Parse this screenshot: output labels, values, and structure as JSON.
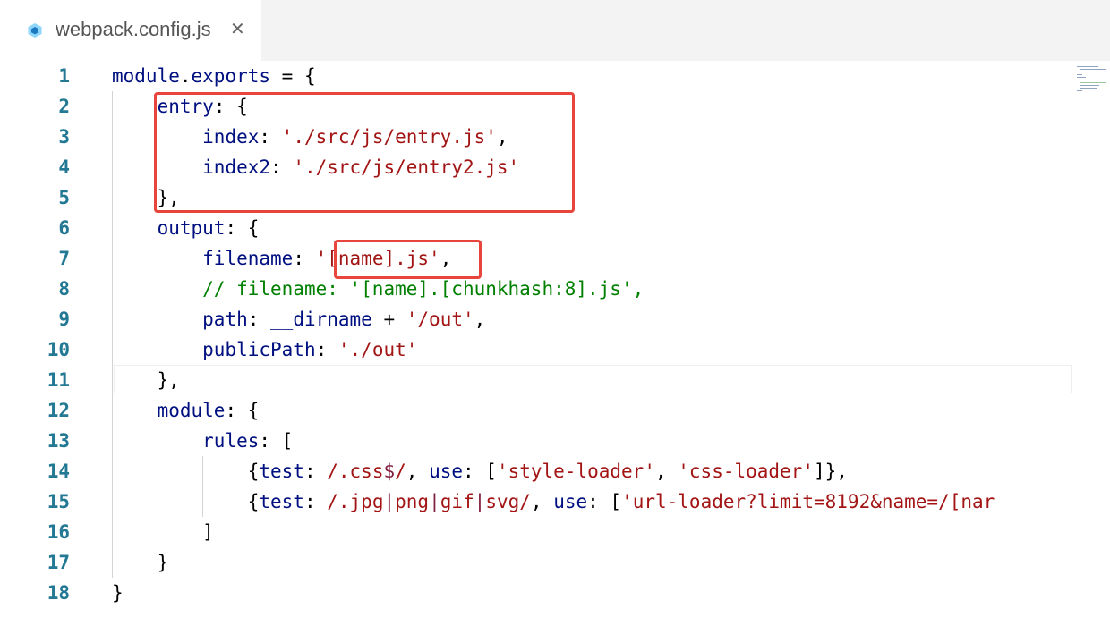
{
  "tab": {
    "icon": "webpack-cube-icon",
    "filename": "webpack.config.js",
    "close_glyph": "✕"
  },
  "editor": {
    "current_line": 11,
    "highlight_boxes": [
      "entry-block",
      "filename-value"
    ],
    "colors": {
      "line_number": "#237893",
      "property": "#001080",
      "string": "#a31515",
      "comment": "#008000",
      "highlight_box": "#e8453c"
    },
    "lines": [
      {
        "num": "1",
        "segs": [
          {
            "t": "module",
            "c": "k"
          },
          {
            "t": ".",
            "c": ""
          },
          {
            "t": "exports",
            "c": "k"
          },
          {
            "t": " = {",
            "c": ""
          }
        ]
      },
      {
        "num": "2",
        "segs": [
          {
            "t": "    ",
            "c": ""
          },
          {
            "t": "entry",
            "c": "k"
          },
          {
            "t": ": {",
            "c": ""
          }
        ]
      },
      {
        "num": "3",
        "segs": [
          {
            "t": "        ",
            "c": ""
          },
          {
            "t": "index",
            "c": "k"
          },
          {
            "t": ": ",
            "c": ""
          },
          {
            "t": "'./src/js/entry.js'",
            "c": "s"
          },
          {
            "t": ",",
            "c": ""
          }
        ]
      },
      {
        "num": "4",
        "segs": [
          {
            "t": "        ",
            "c": ""
          },
          {
            "t": "index2",
            "c": "k"
          },
          {
            "t": ": ",
            "c": ""
          },
          {
            "t": "'./src/js/entry2.js'",
            "c": "s"
          }
        ]
      },
      {
        "num": "5",
        "segs": [
          {
            "t": "    },",
            "c": ""
          }
        ]
      },
      {
        "num": "6",
        "segs": [
          {
            "t": "    ",
            "c": ""
          },
          {
            "t": "output",
            "c": "k"
          },
          {
            "t": ": {",
            "c": ""
          }
        ]
      },
      {
        "num": "7",
        "segs": [
          {
            "t": "        ",
            "c": ""
          },
          {
            "t": "filename",
            "c": "k"
          },
          {
            "t": ": ",
            "c": ""
          },
          {
            "t": "'[name].js'",
            "c": "s"
          },
          {
            "t": ",",
            "c": ""
          }
        ]
      },
      {
        "num": "8",
        "segs": [
          {
            "t": "        ",
            "c": ""
          },
          {
            "t": "// filename: '[name].[chunkhash:8].js',",
            "c": "c"
          }
        ]
      },
      {
        "num": "9",
        "segs": [
          {
            "t": "        ",
            "c": ""
          },
          {
            "t": "path",
            "c": "k"
          },
          {
            "t": ": ",
            "c": ""
          },
          {
            "t": "__dirname",
            "c": "k"
          },
          {
            "t": " + ",
            "c": ""
          },
          {
            "t": "'/out'",
            "c": "s"
          },
          {
            "t": ",",
            "c": ""
          }
        ]
      },
      {
        "num": "10",
        "segs": [
          {
            "t": "        ",
            "c": ""
          },
          {
            "t": "publicPath",
            "c": "k"
          },
          {
            "t": ": ",
            "c": ""
          },
          {
            "t": "'./out'",
            "c": "s"
          }
        ]
      },
      {
        "num": "11",
        "segs": [
          {
            "t": "    },",
            "c": ""
          }
        ]
      },
      {
        "num": "12",
        "segs": [
          {
            "t": "    ",
            "c": ""
          },
          {
            "t": "module",
            "c": "k"
          },
          {
            "t": ": {",
            "c": ""
          }
        ]
      },
      {
        "num": "13",
        "segs": [
          {
            "t": "        ",
            "c": ""
          },
          {
            "t": "rules",
            "c": "k"
          },
          {
            "t": ": [",
            "c": ""
          }
        ]
      },
      {
        "num": "14",
        "segs": [
          {
            "t": "            {",
            "c": ""
          },
          {
            "t": "test",
            "c": "k"
          },
          {
            "t": ": ",
            "c": ""
          },
          {
            "t": "/.css",
            "c": "s"
          },
          {
            "t": "$",
            "c": "r"
          },
          {
            "t": "/",
            "c": "s"
          },
          {
            "t": ", ",
            "c": ""
          },
          {
            "t": "use",
            "c": "k"
          },
          {
            "t": ": [",
            "c": ""
          },
          {
            "t": "'style-loader'",
            "c": "s"
          },
          {
            "t": ", ",
            "c": ""
          },
          {
            "t": "'css-loader'",
            "c": "s"
          },
          {
            "t": "]},",
            "c": ""
          }
        ]
      },
      {
        "num": "15",
        "segs": [
          {
            "t": "            {",
            "c": ""
          },
          {
            "t": "test",
            "c": "k"
          },
          {
            "t": ": ",
            "c": ""
          },
          {
            "t": "/.jpg",
            "c": "s"
          },
          {
            "t": "|",
            "c": "r"
          },
          {
            "t": "png",
            "c": "s"
          },
          {
            "t": "|",
            "c": "r"
          },
          {
            "t": "gif",
            "c": "s"
          },
          {
            "t": "|",
            "c": "r"
          },
          {
            "t": "svg/",
            "c": "s"
          },
          {
            "t": ", ",
            "c": ""
          },
          {
            "t": "use",
            "c": "k"
          },
          {
            "t": ": [",
            "c": ""
          },
          {
            "t": "'url-loader?limit=8192&name=/[nar",
            "c": "s"
          }
        ]
      },
      {
        "num": "16",
        "segs": [
          {
            "t": "        ]",
            "c": ""
          }
        ]
      },
      {
        "num": "17",
        "segs": [
          {
            "t": "    }",
            "c": ""
          }
        ]
      },
      {
        "num": "18",
        "segs": [
          {
            "t": "}",
            "c": ""
          }
        ]
      }
    ]
  }
}
